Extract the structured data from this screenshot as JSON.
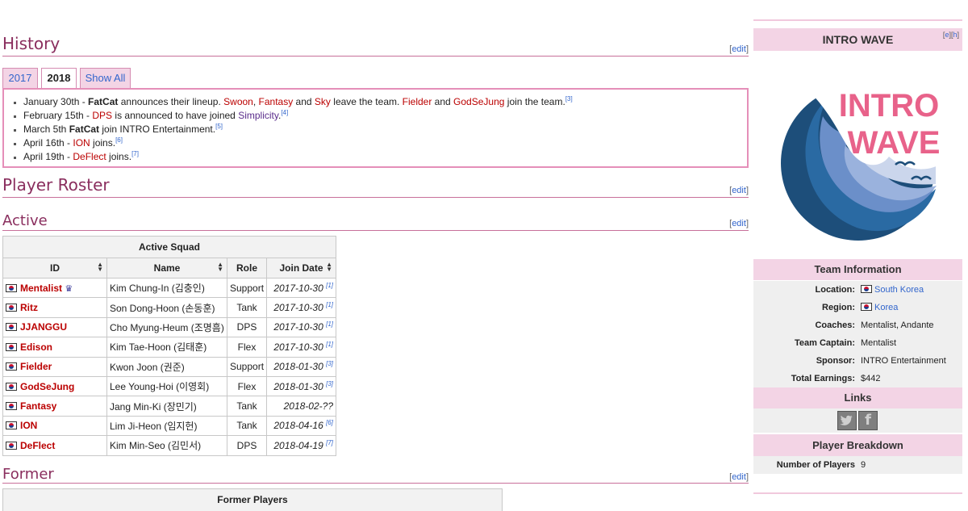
{
  "history": {
    "title": "History",
    "edit": "edit",
    "tabs": [
      "2017",
      "2018",
      "Show All"
    ],
    "active_tab": "2018",
    "entries": [
      [
        {
          "t": "January 30th - "
        },
        {
          "t": "FatCat",
          "b": true
        },
        {
          "t": " announces their lineup. "
        },
        {
          "t": "Swoon",
          "c": "red"
        },
        {
          "t": ", "
        },
        {
          "t": "Fantasy",
          "c": "red"
        },
        {
          "t": " and "
        },
        {
          "t": "Sky",
          "c": "red"
        },
        {
          "t": " leave the team. "
        },
        {
          "t": "Fielder",
          "c": "red"
        },
        {
          "t": " and "
        },
        {
          "t": "GodSeJung",
          "c": "red"
        },
        {
          "t": " join the team."
        },
        {
          "t": "[3]",
          "ref": true
        }
      ],
      [
        {
          "t": "February 15th - "
        },
        {
          "t": "DPS",
          "c": "red"
        },
        {
          "t": " is announced to have joined "
        },
        {
          "t": "Simplicity",
          "c": "purple"
        },
        {
          "t": "."
        },
        {
          "t": "[4]",
          "ref": true
        }
      ],
      [
        {
          "t": "March 5th "
        },
        {
          "t": "FatCat",
          "b": true
        },
        {
          "t": " join INTRO Entertainment."
        },
        {
          "t": "[5]",
          "ref": true
        }
      ],
      [
        {
          "t": "April 16th - "
        },
        {
          "t": "ION",
          "c": "red"
        },
        {
          "t": " joins."
        },
        {
          "t": "[6]",
          "ref": true
        }
      ],
      [
        {
          "t": "April 19th - "
        },
        {
          "t": "DeFlect",
          "c": "red"
        },
        {
          "t": " joins."
        },
        {
          "t": "[7]",
          "ref": true
        }
      ]
    ]
  },
  "roster": {
    "title": "Player Roster",
    "edit": "edit",
    "active_title": "Active",
    "active_edit": "edit",
    "caption": "Active Squad",
    "headers": [
      "ID",
      "Name",
      "Role",
      "Join Date"
    ],
    "players": [
      {
        "id": "Mentalist",
        "captain": true,
        "name": "Kim Chung-In (김충인)",
        "role": "Support",
        "date": "2017-10-30",
        "ref": "[1]"
      },
      {
        "id": "Ritz",
        "name": "Son Dong-Hoon (손동훈)",
        "role": "Tank",
        "date": "2017-10-30",
        "ref": "[1]"
      },
      {
        "id": "JJANGGU",
        "name": "Cho Myung-Heum (조명흠)",
        "role": "DPS",
        "date": "2017-10-30",
        "ref": "[1]"
      },
      {
        "id": "Edison",
        "name": "Kim Tae-Hoon (김태훈)",
        "role": "Flex",
        "date": "2017-10-30",
        "ref": "[1]"
      },
      {
        "id": "Fielder",
        "name": "Kwon Joon (권준)",
        "role": "Support",
        "date": "2018-01-30",
        "ref": "[3]"
      },
      {
        "id": "GodSeJung",
        "name": "Lee Young-Hoi (이영회)",
        "role": "Flex",
        "date": "2018-01-30",
        "ref": "[3]"
      },
      {
        "id": "Fantasy",
        "name": "Jang Min-Ki (장민기)",
        "role": "Tank",
        "date": "2018-02-??",
        "ref": ""
      },
      {
        "id": "ION",
        "name": "Lim Ji-Heon (임지헌)",
        "role": "Tank",
        "date": "2018-04-16",
        "ref": "[6]"
      },
      {
        "id": "DeFlect",
        "name": "Kim Min-Seo (김민서)",
        "role": "DPS",
        "date": "2018-04-19",
        "ref": "[7]"
      }
    ],
    "former_title": "Former",
    "former_edit": "edit",
    "former_caption": "Former Players"
  },
  "infobox": {
    "title": "INTRO WAVE",
    "edit_links": [
      "e",
      "h"
    ],
    "logo_text": [
      "INTRO",
      "WAVE"
    ],
    "team_info_title": "Team Information",
    "location_label": "Location:",
    "location_value": "South Korea",
    "region_label": "Region:",
    "region_value": "Korea",
    "coaches_label": "Coaches:",
    "coaches_value": "Mentalist, Andante",
    "captain_label": "Team Captain:",
    "captain_value": "Mentalist",
    "sponsor_label": "Sponsor:",
    "sponsor_value": "INTRO Entertainment",
    "earnings_label": "Total Earnings:",
    "earnings_value": "$442",
    "links_title": "Links",
    "breakdown_title": "Player Breakdown",
    "players_label": "Number of Players",
    "players_value": "9"
  },
  "colors": {
    "heading": "#8a2e5e",
    "accent_pink": "#f3d4e5",
    "link_red": "#bb0000",
    "link_blue": "#3366cc",
    "logo_pink": "#e8628a",
    "logo_navy": "#1d4e7a"
  }
}
